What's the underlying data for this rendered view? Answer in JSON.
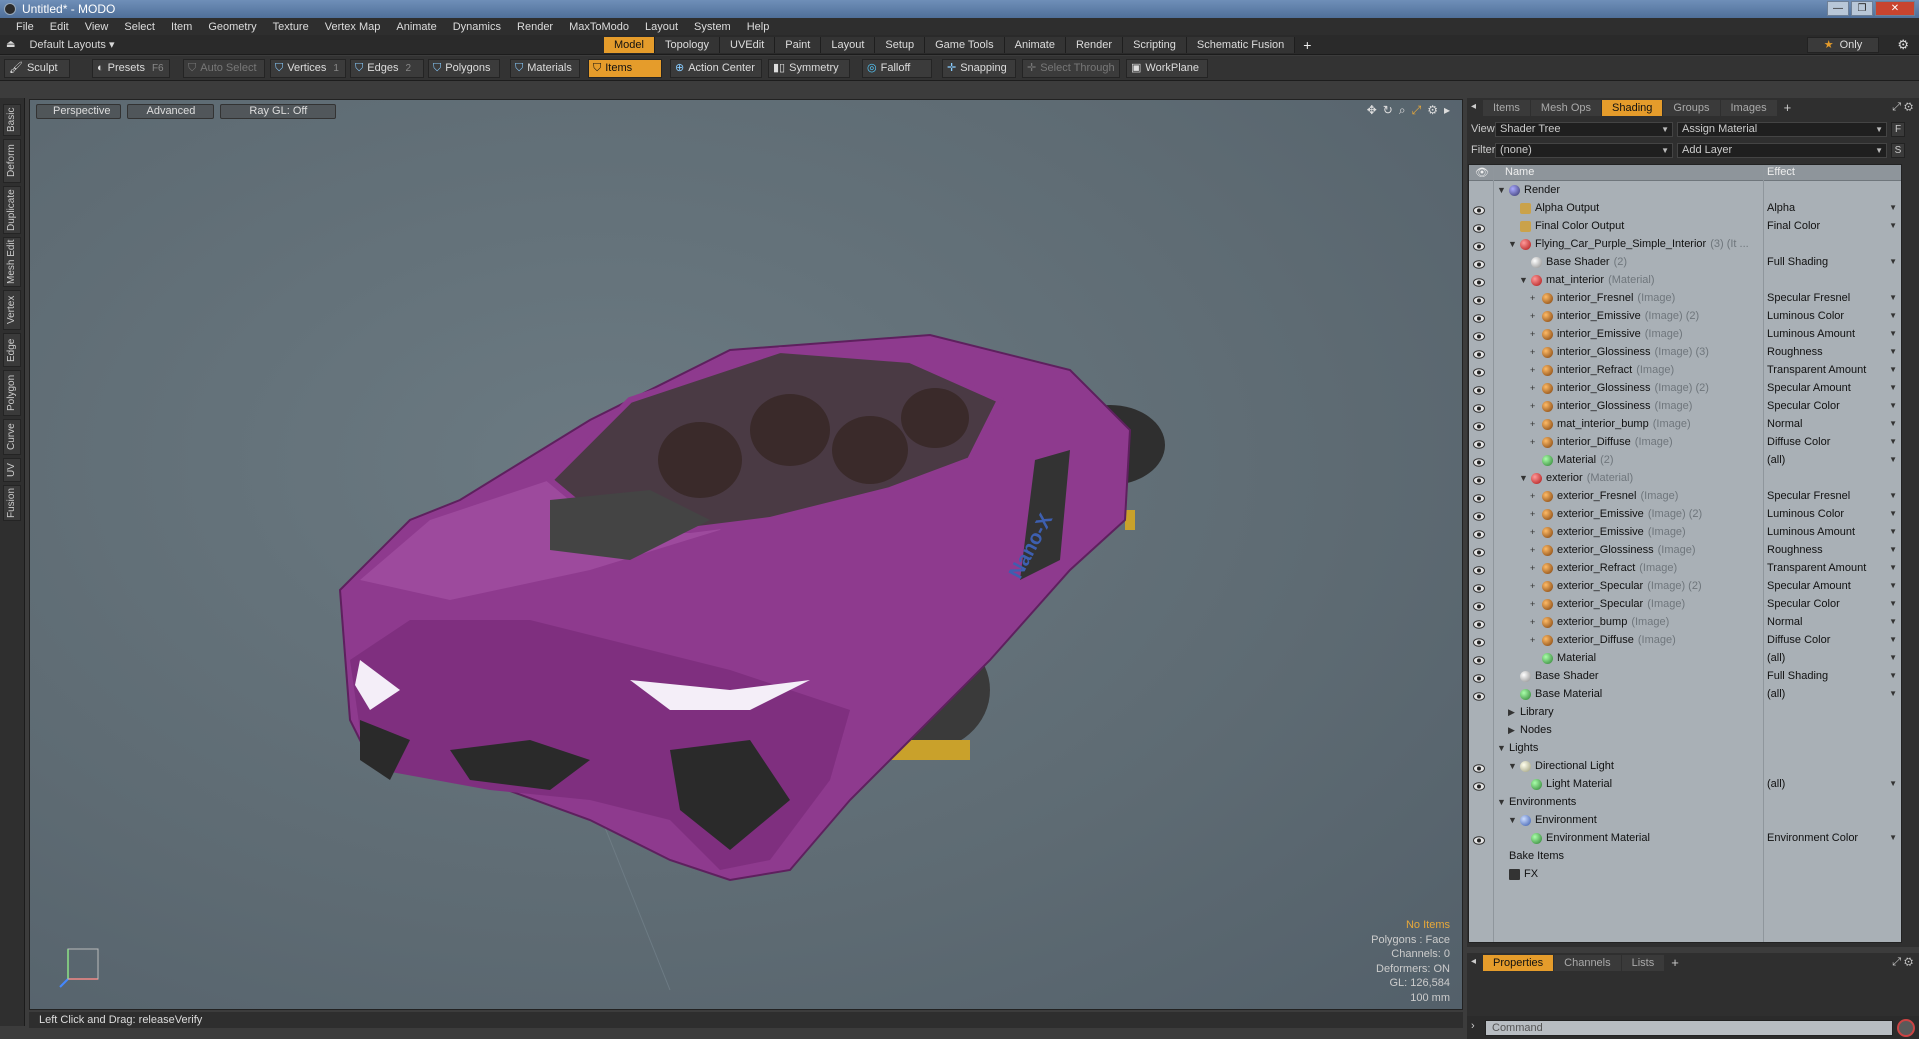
{
  "window": {
    "title": "Untitled* - MODO",
    "controls": [
      "—",
      "❐",
      "✕"
    ]
  },
  "menu": [
    "File",
    "Edit",
    "View",
    "Select",
    "Item",
    "Geometry",
    "Texture",
    "Vertex Map",
    "Animate",
    "Dynamics",
    "Render",
    "MaxToModo",
    "Layout",
    "System",
    "Help"
  ],
  "layouts": {
    "label": "Default Layouts"
  },
  "tabs": [
    {
      "label": "Model",
      "active": true
    },
    {
      "label": "Topology"
    },
    {
      "label": "UVEdit"
    },
    {
      "label": "Paint"
    },
    {
      "label": "Layout"
    },
    {
      "label": "Setup"
    },
    {
      "label": "Game Tools"
    },
    {
      "label": "Animate"
    },
    {
      "label": "Render"
    },
    {
      "label": "Scripting"
    },
    {
      "label": "Schematic Fusion"
    }
  ],
  "tabs_plus": "+",
  "only_label": "Only",
  "toolbar": {
    "sculpt": "Sculpt",
    "presets": "Presets",
    "presets_key": "F6",
    "auto_select": "Auto Select",
    "vertices": "Vertices",
    "vertices_num": "1",
    "edges": "Edges",
    "edges_num": "2",
    "polygons": "Polygons",
    "materials": "Materials",
    "items": "Items",
    "action_center": "Action Center",
    "symmetry": "Symmetry",
    "falloff": "Falloff",
    "snapping": "Snapping",
    "select_through": "Select Through",
    "workplane": "WorkPlane"
  },
  "left_tabs": [
    "Basic",
    "Deform",
    "Duplicate",
    "Mesh Edit",
    "Vertex",
    "Edge",
    "Polygon",
    "Curve",
    "UV",
    "Fusion"
  ],
  "viewport": {
    "view": "Perspective",
    "advanced": "Advanced",
    "raygl": "Ray GL: Off",
    "info": {
      "no_items": "No Items",
      "polygons": "Polygons : Face",
      "channels": "Channels: 0",
      "deformers": "Deformers: ON",
      "gl": "GL: 126,584",
      "scale": "100 mm"
    },
    "car_label": "Nano-X"
  },
  "status": "Left Click and Drag:  releaseVerify",
  "right_panel": {
    "tabs": [
      {
        "label": "Items"
      },
      {
        "label": "Mesh Ops"
      },
      {
        "label": "Shading",
        "active": true
      },
      {
        "label": "Groups"
      },
      {
        "label": "Images"
      }
    ],
    "view_label": "View",
    "view_value": "Shader Tree",
    "assign_material": "Assign Material",
    "assign_btn": "F",
    "filter_label": "Filter",
    "filter_value": "(none)",
    "add_layer": "Add Layer",
    "add_btn": "S",
    "col_name": "Name",
    "col_effect": "Effect"
  },
  "tree": [
    {
      "indent": 0,
      "tw": "▼",
      "icon": "b-render",
      "name": "Render",
      "sub": "",
      "effect": "",
      "eye": false
    },
    {
      "indent": 1,
      "tw": "",
      "icon": "b-out",
      "name": "Alpha Output",
      "sub": "",
      "effect": "Alpha",
      "eye": true
    },
    {
      "indent": 1,
      "tw": "",
      "icon": "b-out",
      "name": "Final Color Output",
      "sub": "",
      "effect": "Final Color",
      "eye": true
    },
    {
      "indent": 1,
      "tw": "▼",
      "icon": "b-red",
      "name": "Flying_Car_Purple_Simple_Interior",
      "sub": "(3) (It ...",
      "effect": "",
      "eye": true
    },
    {
      "indent": 2,
      "tw": "",
      "icon": "b-shader",
      "name": "Base Shader",
      "sub": "(2)",
      "effect": "Full Shading",
      "eye": true
    },
    {
      "indent": 2,
      "tw": "▼",
      "icon": "b-red",
      "name": "mat_interior",
      "sub": "(Material)",
      "effect": "",
      "eye": true
    },
    {
      "indent": 3,
      "tw": "+",
      "icon": "b-img",
      "name": "interior_Fresnel",
      "sub": "(Image)",
      "effect": "Specular Fresnel",
      "eye": true
    },
    {
      "indent": 3,
      "tw": "+",
      "icon": "b-img",
      "name": "interior_Emissive",
      "sub": "(Image) (2)",
      "effect": "Luminous Color",
      "eye": true
    },
    {
      "indent": 3,
      "tw": "+",
      "icon": "b-img",
      "name": "interior_Emissive",
      "sub": "(Image)",
      "effect": "Luminous Amount",
      "eye": true
    },
    {
      "indent": 3,
      "tw": "+",
      "icon": "b-img",
      "name": "interior_Glossiness",
      "sub": "(Image) (3)",
      "effect": "Roughness",
      "eye": true
    },
    {
      "indent": 3,
      "tw": "+",
      "icon": "b-img",
      "name": "interior_Refract",
      "sub": "(Image)",
      "effect": "Transparent Amount",
      "eye": true
    },
    {
      "indent": 3,
      "tw": "+",
      "icon": "b-img",
      "name": "interior_Glossiness",
      "sub": "(Image) (2)",
      "effect": "Specular Amount",
      "eye": true
    },
    {
      "indent": 3,
      "tw": "+",
      "icon": "b-img",
      "name": "interior_Glossiness",
      "sub": "(Image)",
      "effect": "Specular Color",
      "eye": true
    },
    {
      "indent": 3,
      "tw": "+",
      "icon": "b-img",
      "name": "mat_interior_bump",
      "sub": "(Image)",
      "effect": "Normal",
      "eye": true
    },
    {
      "indent": 3,
      "tw": "+",
      "icon": "b-img",
      "name": "interior_Diffuse",
      "sub": "(Image)",
      "effect": "Diffuse Color",
      "eye": true
    },
    {
      "indent": 3,
      "tw": "",
      "icon": "b-mat",
      "name": "Material",
      "sub": "(2)",
      "effect": "(all)",
      "eye": true
    },
    {
      "indent": 2,
      "tw": "▼",
      "icon": "b-red",
      "name": "exterior",
      "sub": "(Material)",
      "effect": "",
      "eye": true
    },
    {
      "indent": 3,
      "tw": "+",
      "icon": "b-img",
      "name": "exterior_Fresnel",
      "sub": "(Image)",
      "effect": "Specular Fresnel",
      "eye": true
    },
    {
      "indent": 3,
      "tw": "+",
      "icon": "b-img",
      "name": "exterior_Emissive",
      "sub": "(Image) (2)",
      "effect": "Luminous Color",
      "eye": true
    },
    {
      "indent": 3,
      "tw": "+",
      "icon": "b-img",
      "name": "exterior_Emissive",
      "sub": "(Image)",
      "effect": "Luminous Amount",
      "eye": true
    },
    {
      "indent": 3,
      "tw": "+",
      "icon": "b-img",
      "name": "exterior_Glossiness",
      "sub": "(Image)",
      "effect": "Roughness",
      "eye": true
    },
    {
      "indent": 3,
      "tw": "+",
      "icon": "b-img",
      "name": "exterior_Refract",
      "sub": "(Image)",
      "effect": "Transparent Amount",
      "eye": true
    },
    {
      "indent": 3,
      "tw": "+",
      "icon": "b-img",
      "name": "exterior_Specular",
      "sub": "(Image) (2)",
      "effect": "Specular Amount",
      "eye": true
    },
    {
      "indent": 3,
      "tw": "+",
      "icon": "b-img",
      "name": "exterior_Specular",
      "sub": "(Image)",
      "effect": "Specular Color",
      "eye": true
    },
    {
      "indent": 3,
      "tw": "+",
      "icon": "b-img",
      "name": "exterior_bump",
      "sub": "(Image)",
      "effect": "Normal",
      "eye": true
    },
    {
      "indent": 3,
      "tw": "+",
      "icon": "b-img",
      "name": "exterior_Diffuse",
      "sub": "(Image)",
      "effect": "Diffuse Color",
      "eye": true
    },
    {
      "indent": 3,
      "tw": "",
      "icon": "b-mat",
      "name": "Material",
      "sub": "",
      "effect": "(all)",
      "eye": true
    },
    {
      "indent": 1,
      "tw": "",
      "icon": "b-shader",
      "name": "Base Shader",
      "sub": "",
      "effect": "Full Shading",
      "eye": true
    },
    {
      "indent": 1,
      "tw": "",
      "icon": "b-mat",
      "name": "Base Material",
      "sub": "",
      "effect": "(all)",
      "eye": true
    },
    {
      "indent": 1,
      "tw": "▶",
      "icon": "",
      "name": "Library",
      "sub": "",
      "effect": "",
      "eye": false
    },
    {
      "indent": 1,
      "tw": "▶",
      "icon": "",
      "name": "Nodes",
      "sub": "",
      "effect": "",
      "eye": false
    },
    {
      "indent": 0,
      "tw": "▼",
      "icon": "",
      "name": "Lights",
      "sub": "",
      "effect": "",
      "eye": false
    },
    {
      "indent": 1,
      "tw": "▼",
      "icon": "b-light",
      "name": "Directional Light",
      "sub": "",
      "effect": "",
      "eye": true
    },
    {
      "indent": 2,
      "tw": "",
      "icon": "b-mat",
      "name": "Light Material",
      "sub": "",
      "effect": "(all)",
      "eye": true
    },
    {
      "indent": 0,
      "tw": "▼",
      "icon": "",
      "name": "Environments",
      "sub": "",
      "effect": "",
      "eye": false
    },
    {
      "indent": 1,
      "tw": "▼",
      "icon": "b-env",
      "name": "Environment",
      "sub": "",
      "effect": "",
      "eye": false
    },
    {
      "indent": 2,
      "tw": "",
      "icon": "b-mat",
      "name": "Environment Material",
      "sub": "",
      "effect": "Environment Color",
      "eye": true
    },
    {
      "indent": 0,
      "tw": "",
      "icon": "",
      "name": "Bake Items",
      "sub": "",
      "effect": "",
      "eye": false
    },
    {
      "indent": 0,
      "tw": "",
      "icon": "b-fx",
      "name": "FX",
      "sub": "",
      "effect": "",
      "eye": false
    }
  ],
  "props_tabs": [
    {
      "label": "Properties",
      "active": true
    },
    {
      "label": "Channels"
    },
    {
      "label": "Lists"
    }
  ],
  "command_placeholder": "Command"
}
